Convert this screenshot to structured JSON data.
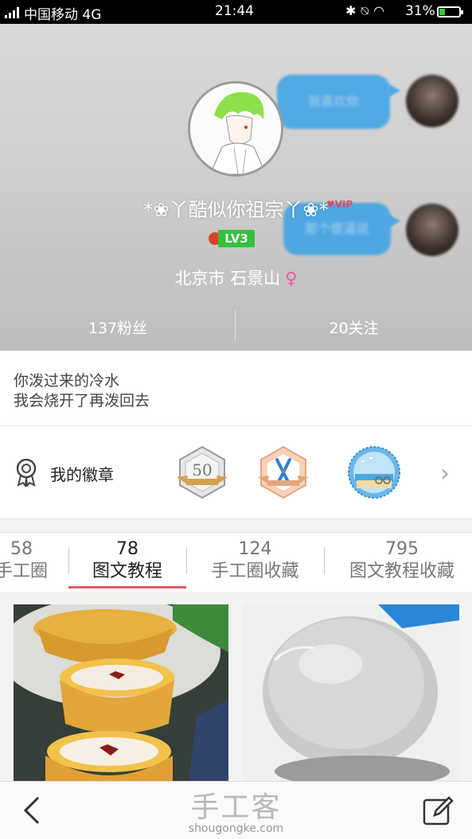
{
  "status_bar": {
    "carrier": "中国移动 4G",
    "time": "21:44",
    "battery": "31%",
    "battery_level": 0.31
  },
  "profile": {
    "chat_bubble_1": "我喜欢你",
    "chat_bubble_2": "那个傻逼说",
    "nickname": "*❀丫酷似你祖宗丫❀*",
    "vip_label": "VIP",
    "level": "LV3",
    "location": "北京市 石景山",
    "gender_symbol": "♀",
    "fans": "137粉丝",
    "following": "20关注"
  },
  "bio": {
    "line1": "你泼过来的冷水",
    "line2": "我会烧开了再泼回去"
  },
  "badges": {
    "title": "我的徽章",
    "badge1_text": "50"
  },
  "tabs": [
    {
      "count": "58",
      "label": "手工圈"
    },
    {
      "count": "78",
      "label": "图文教程"
    },
    {
      "count": "124",
      "label": "手工圈收藏"
    },
    {
      "count": "795",
      "label": "图文教程收藏"
    }
  ],
  "watermark": {
    "big": "手工客",
    "small": "shougongke.com"
  },
  "colors": {
    "accent": "#e25c5c",
    "level_badge": "#37c03f",
    "chat_bubble": "#3aa2e6",
    "gender": "#e8599a"
  }
}
